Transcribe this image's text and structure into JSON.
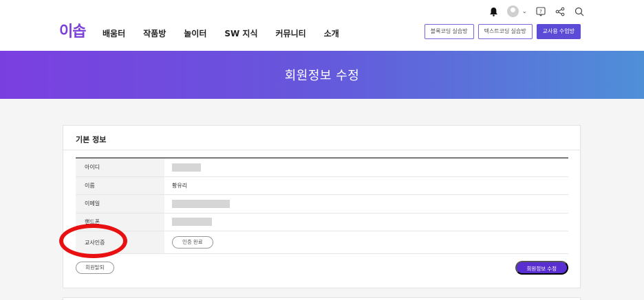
{
  "header": {
    "logo_text": "이솝",
    "nav": [
      "배움터",
      "작품방",
      "놀이터",
      "SW 지식",
      "커뮤니티",
      "소개"
    ],
    "icons": [
      "bell-icon",
      "avatar-icon",
      "chevron-down-icon",
      "help-icon",
      "share-icon",
      "search-icon"
    ],
    "buttons": {
      "block_coding": "블록코딩 실습방",
      "text_coding": "텍스트코딩 실습방",
      "teacher_class": "교사용 수업방"
    }
  },
  "banner": {
    "title": "회원정보 수정"
  },
  "card": {
    "title": "기본 정보",
    "rows": {
      "id_label": "아이디",
      "name_label": "이름",
      "name_value": "황유리",
      "email_label": "이메일",
      "phone_label": "핸드폰",
      "teacher_label": "교사인증",
      "teacher_status": "인증 완료"
    },
    "withdraw_label": "회원탈퇴",
    "edit_label": "회원정보 수정"
  },
  "colors": {
    "accent": "#5a2fd1",
    "banner_start": "#7b3fe0",
    "banner_end": "#4f8fd8",
    "highlight": "#e81010"
  }
}
